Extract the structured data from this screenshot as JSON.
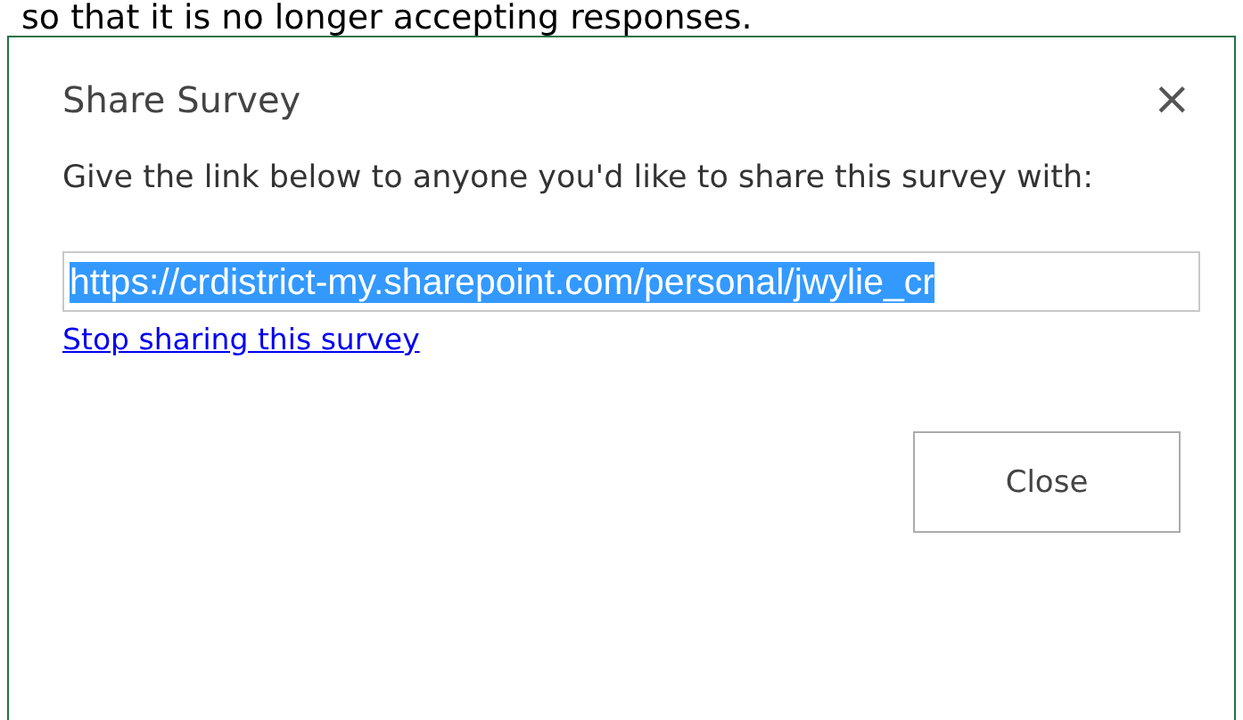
{
  "page_text": "so that it is no longer accepting responses.",
  "dialog": {
    "title": "Share Survey",
    "close_glyph": "×",
    "message": "Give the link below to anyone you'd like to share this survey with:",
    "link_field": {
      "value": "https://crdistrict-my.sharepoint.com/personal/jwylie_cr",
      "text_selected": true
    },
    "stop_link": "Stop sharing this survey",
    "buttons": [
      "Close"
    ]
  }
}
